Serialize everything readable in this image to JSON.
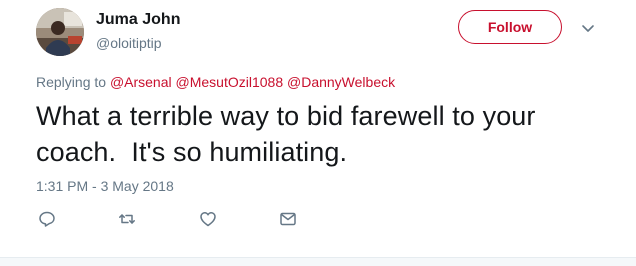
{
  "user": {
    "name": "Juma John",
    "handle": "@oloitiptip"
  },
  "follow_button": {
    "label": "Follow"
  },
  "replying": {
    "prefix": "Replying to",
    "mentions": [
      "@Arsenal",
      "@MesutOzil1088",
      "@DannyWelbeck"
    ]
  },
  "tweet": {
    "line1": "What a terrible way to bid farewell to your",
    "line2": "coach.  It's so humiliating.",
    "timestamp": "1:31 PM - 3 May 2018"
  },
  "actions": {
    "icons": [
      "reply-icon",
      "retweet-icon",
      "like-icon",
      "direct-message-icon"
    ]
  },
  "colors": {
    "accent": "#c8102e",
    "secondary_text": "#657786",
    "primary_text": "#14171a"
  }
}
